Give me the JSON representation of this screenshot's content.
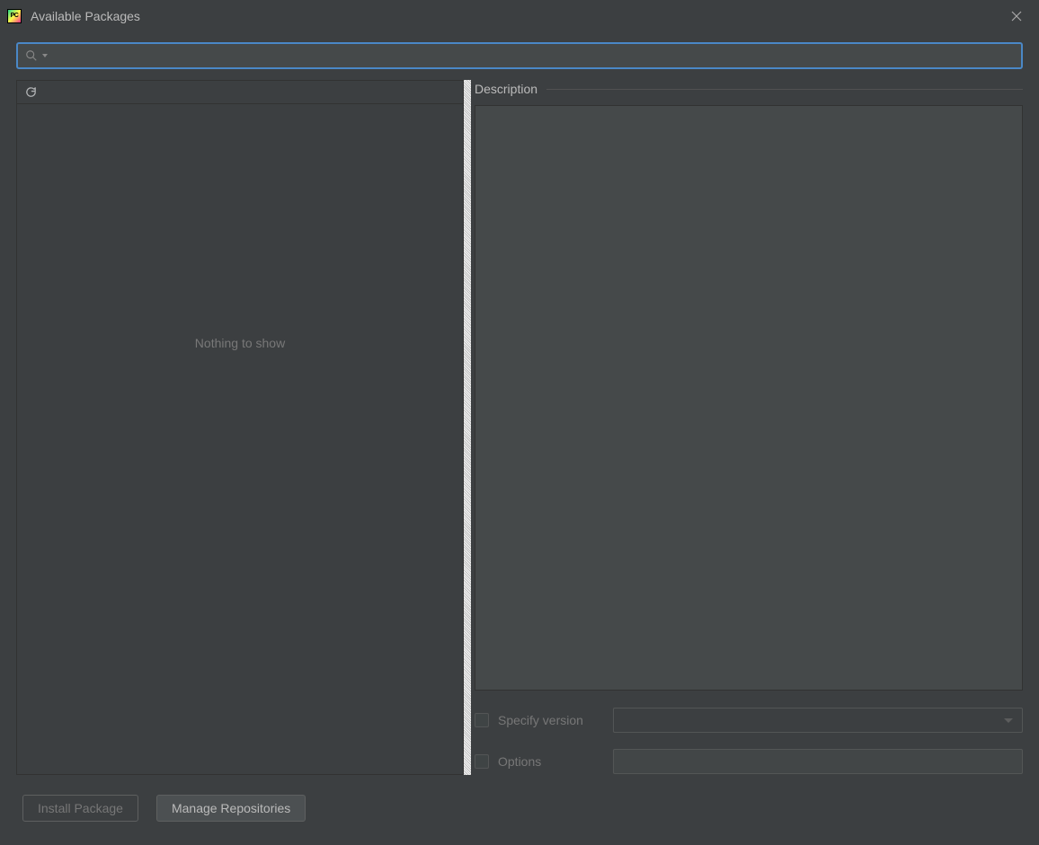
{
  "titlebar": {
    "app_icon_text": "PC",
    "title": "Available Packages"
  },
  "search": {
    "placeholder": "",
    "value": ""
  },
  "left": {
    "empty_text": "Nothing to show"
  },
  "right": {
    "description_label": "Description",
    "specify_version_label": "Specify version",
    "specify_version_value": "",
    "options_label": "Options",
    "options_value": ""
  },
  "footer": {
    "install_label": "Install Package",
    "manage_label": "Manage Repositories"
  }
}
